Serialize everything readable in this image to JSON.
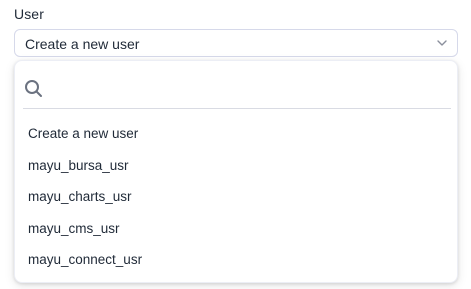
{
  "field": {
    "label": "User",
    "selected_value": "Create a new user"
  },
  "icons": {
    "chevron": "chevron-down-icon",
    "search": "search-icon"
  },
  "search": {
    "value": "",
    "placeholder": ""
  },
  "options": [
    {
      "label": "Create a new user"
    },
    {
      "label": "mayu_bursa_usr"
    },
    {
      "label": "mayu_charts_usr"
    },
    {
      "label": "mayu_cms_usr"
    },
    {
      "label": "mayu_connect_usr"
    }
  ],
  "colors": {
    "border": "#d6d9ea",
    "text": "#1f2937",
    "icon": "#6b7280",
    "divider": "#d9dbe3"
  }
}
